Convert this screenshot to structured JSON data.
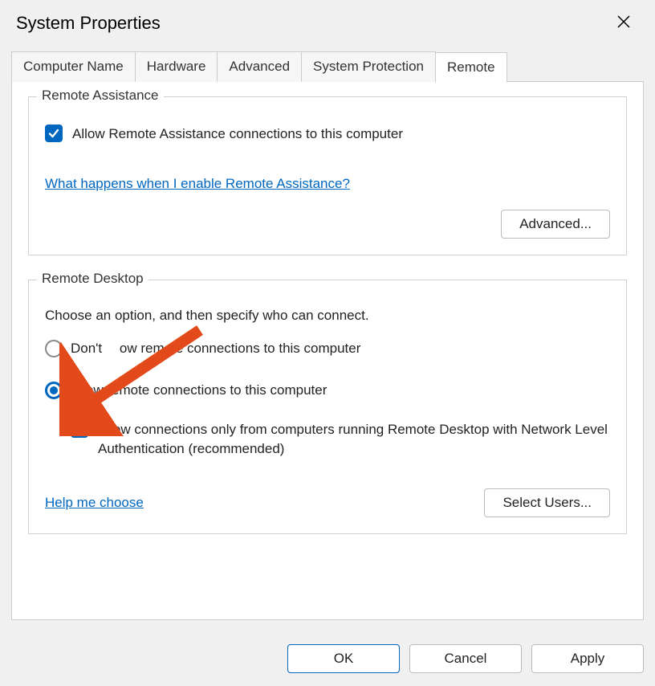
{
  "window": {
    "title": "System Properties"
  },
  "tabs": {
    "computer_name": "Computer Name",
    "hardware": "Hardware",
    "advanced": "Advanced",
    "system_protection": "System Protection",
    "remote": "Remote"
  },
  "remote_assistance": {
    "group_title": "Remote Assistance",
    "allow_label": "Allow Remote Assistance connections to this computer",
    "help_link": "What happens when I enable Remote Assistance?",
    "advanced_btn": "Advanced..."
  },
  "remote_desktop": {
    "group_title": "Remote Desktop",
    "instruction": "Choose an option, and then specify who can connect.",
    "option_deny_prefix": "Don't ",
    "option_deny_suffix": "ow remote connections to this computer",
    "option_allow": "Allow remote connections to this computer",
    "nla_label": "Allow connections only from computers running Remote Desktop with Network Level Authentication (recommended)",
    "help_link": "Help me choose",
    "select_users_btn": "Select Users..."
  },
  "buttons": {
    "ok": "OK",
    "cancel": "Cancel",
    "apply": "Apply"
  }
}
